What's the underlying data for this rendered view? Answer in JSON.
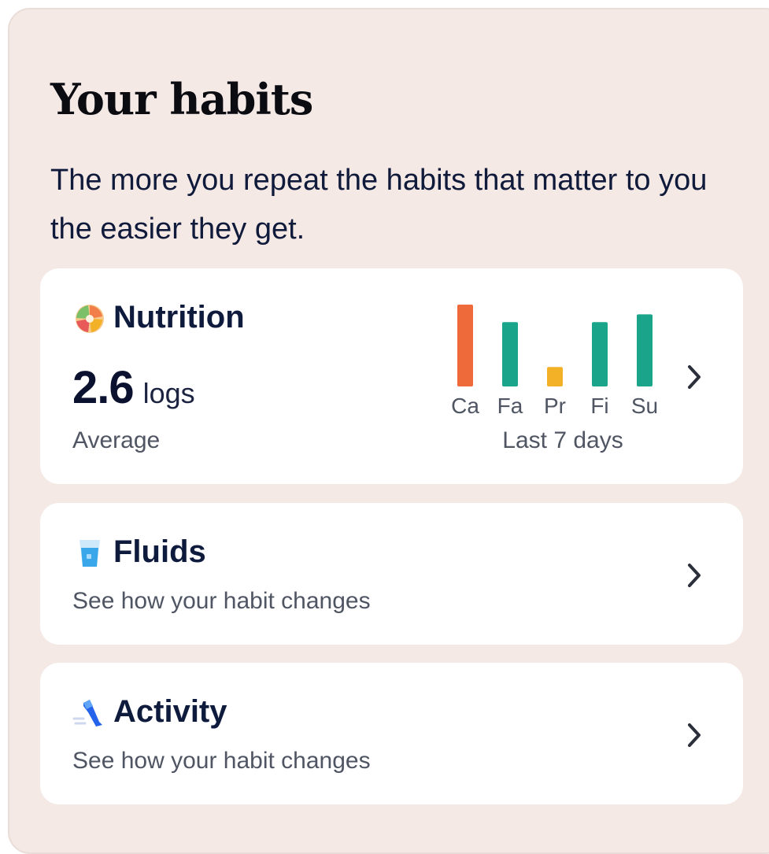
{
  "header": {
    "title": "Your habits",
    "subtitle": "The more you repeat the habits that matter to you the easier they get."
  },
  "nutrition": {
    "title": "Nutrition",
    "icon": "fruit-bowl-icon",
    "value": "2.6",
    "unit": "logs",
    "caption": "Average",
    "chart_caption": "Last 7 days"
  },
  "fluids": {
    "title": "Fluids",
    "icon": "water-glass-icon",
    "subtitle": "See how your habit changes"
  },
  "activity": {
    "title": "Activity",
    "icon": "running-shoe-icon",
    "subtitle": "See how your habit changes"
  },
  "colors": {
    "panel_bg": "#f4e9e5",
    "card_bg": "#ffffff",
    "bar_orange": "#ee6a3a",
    "bar_green": "#1aa58a",
    "bar_yellow": "#f2b126",
    "text_dark": "#0f1b3d",
    "text_muted": "#4f5563"
  },
  "chart_data": {
    "type": "bar",
    "categories": [
      "Ca",
      "Fa",
      "Pr",
      "Fi",
      "Su"
    ],
    "values": [
      4.2,
      3.3,
      1.0,
      3.3,
      3.7
    ],
    "bar_colors": [
      "#ee6a3a",
      "#1aa58a",
      "#f2b126",
      "#1aa58a",
      "#1aa58a"
    ],
    "title": "",
    "xlabel": "Last 7 days",
    "ylabel": "",
    "ylim": [
      0,
      4.2
    ],
    "grid": false,
    "legend": "none"
  }
}
